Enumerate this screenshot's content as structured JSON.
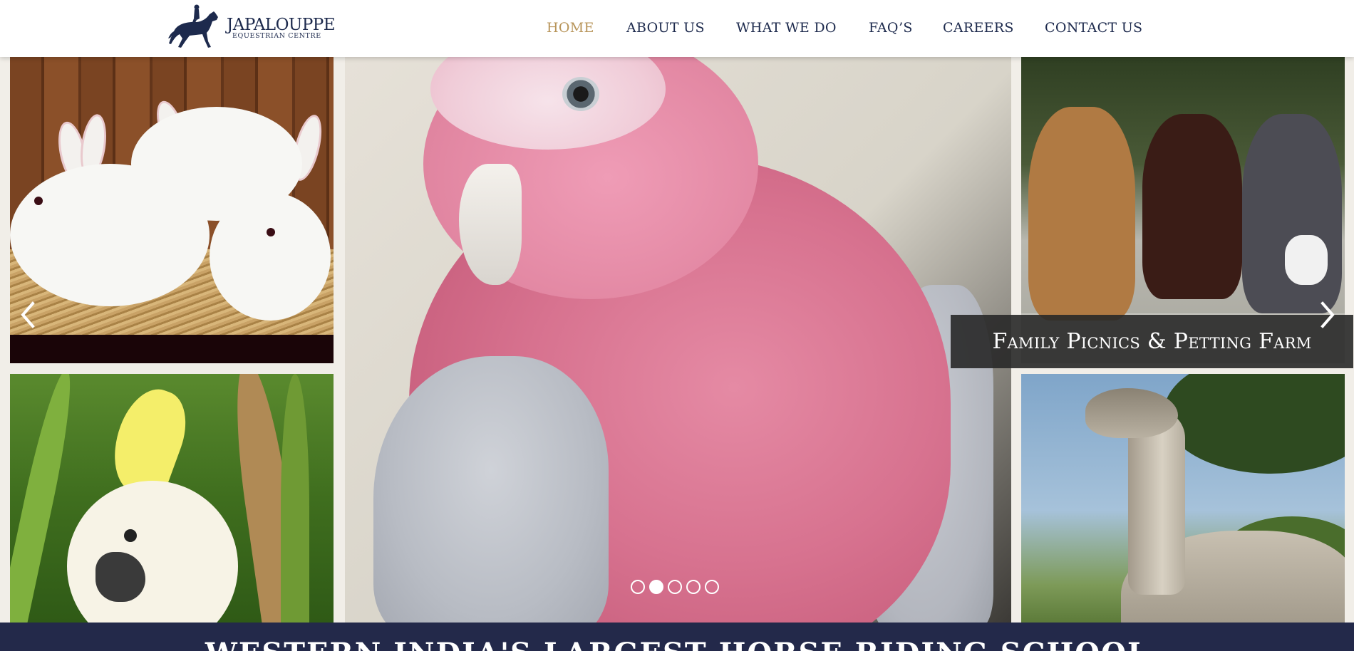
{
  "header": {
    "logo": {
      "name": "JAPALOUPPE",
      "subtitle": "EQUESTRIAN CENTRE",
      "color": "#1d2a4d"
    },
    "nav": [
      {
        "label": "HOME",
        "active": true
      },
      {
        "label": "ABOUT US",
        "active": false
      },
      {
        "label": "WHAT WE DO",
        "active": false
      },
      {
        "label": "FAQ’S",
        "active": false
      },
      {
        "label": "CAREERS",
        "active": false
      },
      {
        "label": "CONTACT US",
        "active": false
      }
    ],
    "colors": {
      "nav_text": "#1d2a4d",
      "nav_active": "#b8955a"
    }
  },
  "slider": {
    "caption": "Family Picnics & Petting Farm",
    "prev_icon": "chevron-left-icon",
    "next_icon": "chevron-right-icon",
    "slide_count": 5,
    "active_slide": 2,
    "images": [
      "rabbits",
      "galah-cockatoo",
      "dogs",
      "sulphur-crested-cockatoo",
      "goose"
    ]
  },
  "banner": {
    "title": "WESTERN INDIA'S LARGEST HORSE RIDING SCHOOL",
    "color": "#23294a"
  }
}
